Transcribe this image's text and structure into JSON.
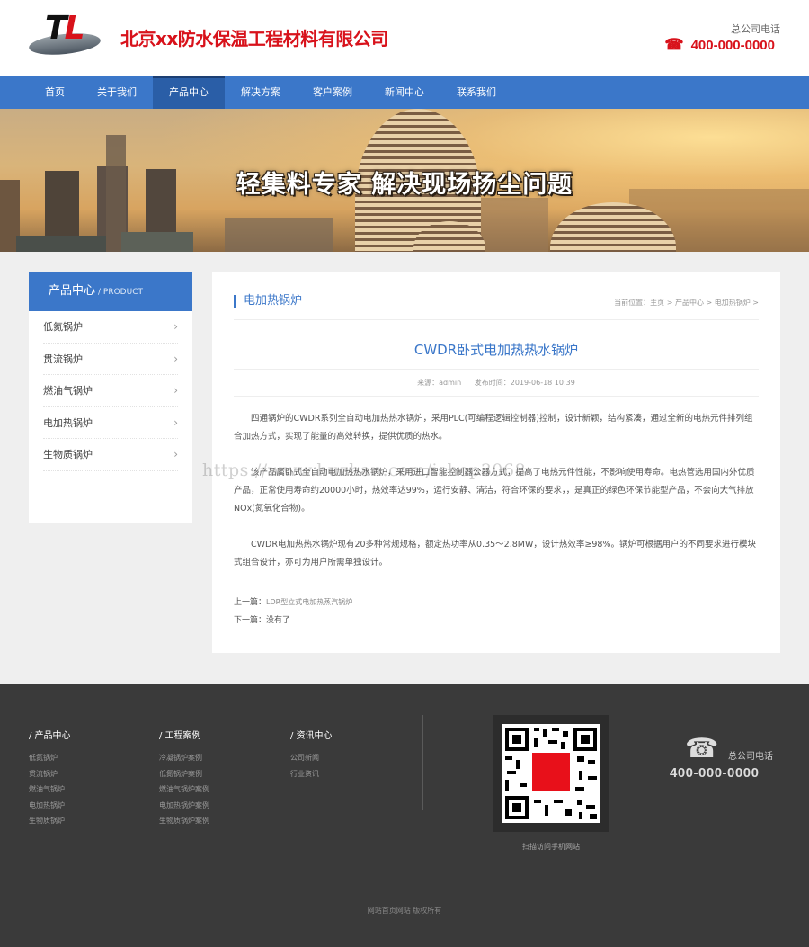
{
  "header": {
    "logo_letters": [
      "T",
      "L"
    ],
    "company_name": "北京xx防水保温工程材料有限公司",
    "phone_label": "总公司电话",
    "phone": "400-000-0000",
    "phone_icon": "telephone-icon"
  },
  "nav": {
    "items": [
      {
        "label": "首页",
        "active": false
      },
      {
        "label": "关于我们",
        "active": false
      },
      {
        "label": "产品中心",
        "active": true
      },
      {
        "label": "解决方案",
        "active": false
      },
      {
        "label": "客户案例",
        "active": false
      },
      {
        "label": "新闻中心",
        "active": false
      },
      {
        "label": "联系我们",
        "active": false
      }
    ]
  },
  "banner": {
    "slogan": "轻集料专家 解决现场扬尘问题"
  },
  "sidebar": {
    "title": "产品中心",
    "subtitle": "/ PRODUCT",
    "items": [
      {
        "label": "低氮锅炉"
      },
      {
        "label": "贯流锅炉"
      },
      {
        "label": "燃油气锅炉"
      },
      {
        "label": "电加热锅炉"
      },
      {
        "label": "生物质锅炉"
      }
    ]
  },
  "content": {
    "section_title": "电加热锅炉",
    "breadcrumb": "当前位置：主页 > 产品中心 > 电加热锅炉 >",
    "article_title": "CWDR卧式电加热热水锅炉",
    "source": "来源：admin",
    "published": "发布时间：2019-06-18 10:39",
    "paragraphs": [
      "四通锅炉的CWDR系列全自动电加热热水锅炉，采用PLC(可编程逻辑控制器)控制，设计新颖，结构紧凑，通过全新的电热元件排列组合加热方式，实现了能量的高效转换，提供优质的热水。",
      "该产品属卧式全自动电加热热水锅炉，采用进口智能控制器公器方式，提高了电热元件性能，不影响使用寿命。电热管选用国内外优质产品，正常使用寿命约20000小时，热效率达99%，运行安静、清洁，符合环保的要求，，是真正的绿色环保节能型产品，不会向大气排放NOx(氮氧化合物)。",
      "CWDR电加热热水锅炉现有20多种常规规格，额定热功率从0.35～2.8MW，设计热效率≥98%。锅炉可根据用户的不同要求进行模块式组合设计，亦可为用户所需单独设计。"
    ],
    "prev_label": "上一篇：",
    "prev_value": "LDR型立式电加热蒸汽锅炉",
    "next_label": "下一篇：",
    "next_value": "没有了"
  },
  "footer": {
    "columns": [
      {
        "title": "/ 产品中心",
        "links": [
          "低氮锅炉",
          "贯流锅炉",
          "燃油气锅炉",
          "电加热锅炉",
          "生物质锅炉"
        ]
      },
      {
        "title": "/ 工程案例",
        "links": [
          "冷凝锅炉案例",
          "低氮锅炉案例",
          "燃油气锅炉案例",
          "电加热锅炉案例",
          "生物质锅炉案例"
        ]
      },
      {
        "title": "/ 资讯中心",
        "links": [
          "公司新闻",
          "行业资讯"
        ]
      }
    ],
    "qr_caption": "扫描访问手机网站",
    "phone_label": "总公司电话",
    "phone": "400-000-0000",
    "copyright": "网站首页网站 版权所有"
  },
  "watermark": "https://www.huzhan.com/ishop3068"
}
